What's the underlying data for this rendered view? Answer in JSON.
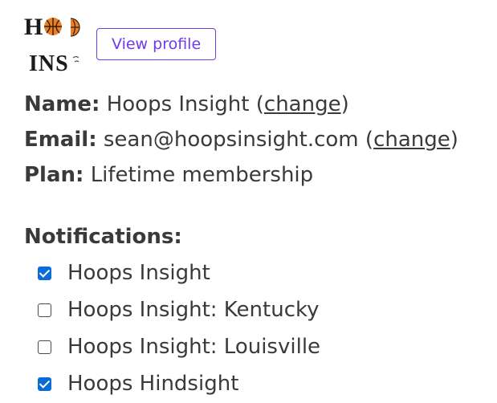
{
  "header": {
    "logo": {
      "line1": "H",
      "line2": "INS",
      "icon": "basketball-icon"
    },
    "view_profile_label": "View profile"
  },
  "account": {
    "name_label": "Name:",
    "name_value": "Hoops Insight",
    "email_label": "Email:",
    "email_value": "sean@hoopsinsight.com",
    "plan_label": "Plan:",
    "plan_value": "Lifetime membership",
    "change_link": "change",
    "open_paren": "(",
    "close_paren": ")"
  },
  "notifications": {
    "title": "Notifications:",
    "items": [
      {
        "label": "Hoops Insight",
        "checked": true
      },
      {
        "label": "Hoops Insight: Kentucky",
        "checked": false
      },
      {
        "label": "Hoops Insight: Louisville",
        "checked": false
      },
      {
        "label": "Hoops Hindsight",
        "checked": true
      }
    ]
  },
  "colors": {
    "accent": "#6d3af0",
    "checkbox_checked": "#0a6cd6",
    "text": "#3a3a3a",
    "basketball": "#e8802a"
  }
}
